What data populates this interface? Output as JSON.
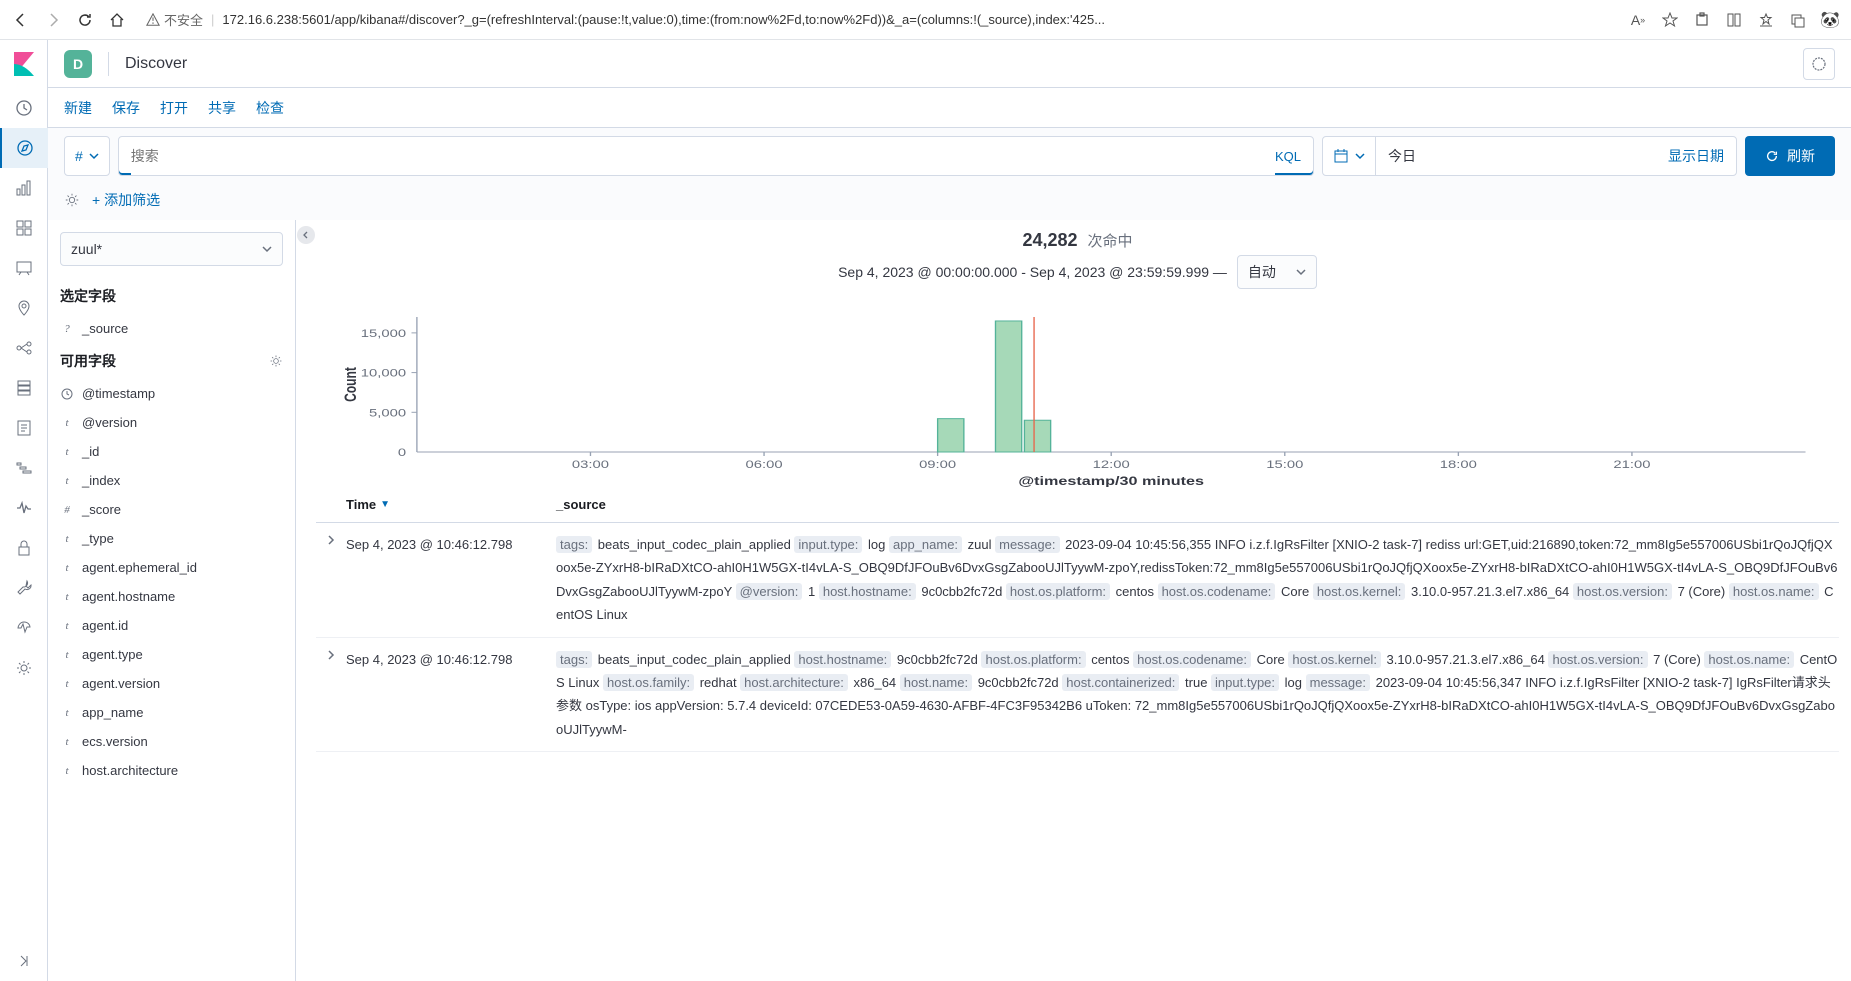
{
  "browser": {
    "insecure_label": "不安全",
    "url": "172.16.6.238:5601/app/kibana#/discover?_g=(refreshInterval:(pause:!t,value:0),time:(from:now%2Fd,to:now%2Fd))&_a=(columns:!(_source),index:'425..."
  },
  "header": {
    "space_letter": "D",
    "title": "Discover"
  },
  "actions": {
    "new": "新建",
    "save": "保存",
    "open": "打开",
    "share": "共享",
    "inspect": "检查"
  },
  "query": {
    "filter_hash": "#",
    "search_placeholder": "搜索",
    "kql": "KQL",
    "date_label": "今日",
    "show_dates": "显示日期",
    "refresh": "刷新",
    "add_filter": "+ 添加筛选"
  },
  "sidebar": {
    "index_pattern": "zuul*",
    "selected_fields_header": "选定字段",
    "selected_fields": [
      {
        "type": "?",
        "name": "_source"
      }
    ],
    "available_fields_header": "可用字段",
    "available_fields": [
      {
        "type": "clock",
        "name": "@timestamp"
      },
      {
        "type": "t",
        "name": "@version"
      },
      {
        "type": "t",
        "name": "_id"
      },
      {
        "type": "t",
        "name": "_index"
      },
      {
        "type": "#",
        "name": "_score"
      },
      {
        "type": "t",
        "name": "_type"
      },
      {
        "type": "t",
        "name": "agent.ephemeral_id"
      },
      {
        "type": "t",
        "name": "agent.hostname"
      },
      {
        "type": "t",
        "name": "agent.id"
      },
      {
        "type": "t",
        "name": "agent.type"
      },
      {
        "type": "t",
        "name": "agent.version"
      },
      {
        "type": "t",
        "name": "app_name"
      },
      {
        "type": "t",
        "name": "ecs.version"
      },
      {
        "type": "t",
        "name": "host.architecture"
      }
    ]
  },
  "results": {
    "hits_count": "24,282",
    "hits_label": "次命中",
    "time_range": "Sep 4, 2023 @ 00:00:00.000 - Sep 4, 2023 @ 23:59:59.999 —",
    "interval": "自动",
    "chart_xlabel": "@timestamp/30 minutes"
  },
  "chart_data": {
    "type": "bar",
    "ylabel": "Count",
    "xlabel": "@timestamp/30 minutes",
    "ylim": [
      0,
      17000
    ],
    "yticks": [
      0,
      5000,
      10000,
      15000
    ],
    "ytick_labels": [
      "0",
      "5,000",
      "10,000",
      "15,000"
    ],
    "xticks": [
      "03:00",
      "06:00",
      "09:00",
      "12:00",
      "15:00",
      "18:00",
      "21:00"
    ],
    "bars": [
      {
        "x_bucket": "09:00",
        "value": 4200
      },
      {
        "x_bucket": "10:00",
        "value": 16500
      },
      {
        "x_bucket": "10:30",
        "value": 4000
      }
    ],
    "current_time_marker": "10:40"
  },
  "table": {
    "col_time": "Time",
    "col_source": "_source",
    "rows": [
      {
        "time": "Sep 4, 2023 @ 10:46:12.798",
        "segments": [
          {
            "k": "tags:",
            "v": " beats_input_codec_plain_applied "
          },
          {
            "k": "input.type:",
            "v": " log "
          },
          {
            "k": "app_name:",
            "v": " zuul "
          },
          {
            "k": "message:",
            "v": " 2023-09-04 10:45:56,355 INFO i.z.f.IgRsFilter [XNIO-2 task-7] rediss url:GET,uid:216890,token:72_mm8Ig5e557006USbi1rQoJQfjQXoox5e-ZYxrH8-bIRaDXtCO-ahI0H1W5GX-tI4vLA-S_OBQ9DfJFOuBv6DvxGsgZabooUJlTyywM-zpoY,redissToken:72_mm8Ig5e557006USbi1rQoJQfjQXoox5e-ZYxrH8-bIRaDXtCO-ahI0H1W5GX-tI4vLA-S_OBQ9DfJFOuBv6DvxGsgZabooUJlTyywM-zpoY "
          },
          {
            "k": "@version:",
            "v": " 1 "
          },
          {
            "k": "host.hostname:",
            "v": " 9c0cbb2fc72d "
          },
          {
            "k": "host.os.platform:",
            "v": " centos "
          },
          {
            "k": "host.os.codename:",
            "v": " Core "
          },
          {
            "k": "host.os.kernel:",
            "v": " 3.10.0-957.21.3.el7.x86_64 "
          },
          {
            "k": "host.os.version:",
            "v": " 7 (Core) "
          },
          {
            "k": "host.os.name:",
            "v": " CentOS Linux"
          }
        ]
      },
      {
        "time": "Sep 4, 2023 @ 10:46:12.798",
        "segments": [
          {
            "k": "tags:",
            "v": " beats_input_codec_plain_applied "
          },
          {
            "k": "host.hostname:",
            "v": " 9c0cbb2fc72d "
          },
          {
            "k": "host.os.platform:",
            "v": " centos "
          },
          {
            "k": "host.os.codename:",
            "v": " Core "
          },
          {
            "k": "host.os.kernel:",
            "v": " 3.10.0-957.21.3.el7.x86_64 "
          },
          {
            "k": "host.os.version:",
            "v": " 7 (Core) "
          },
          {
            "k": "host.os.name:",
            "v": " CentOS Linux "
          },
          {
            "k": "host.os.family:",
            "v": " redhat "
          },
          {
            "k": "host.architecture:",
            "v": " x86_64 "
          },
          {
            "k": "host.name:",
            "v": " 9c0cbb2fc72d "
          },
          {
            "k": "host.containerized:",
            "v": " true "
          },
          {
            "k": "input.type:",
            "v": " log "
          },
          {
            "k": "message:",
            "v": " 2023-09-04 10:45:56,347 INFO i.z.f.IgRsFilter [XNIO-2 task-7] IgRsFilter请求头参数 osType: ios appVersion: 5.7.4 deviceId: 07CEDE53-0A59-4630-AFBF-4FC3F95342B6 uToken: 72_mm8Ig5e557006USbi1rQoJQfjQXoox5e-ZYxrH8-bIRaDXtCO-ahI0H1W5GX-tI4vLA-S_OBQ9DfJFOuBv6DvxGsgZabooUJlTyywM-"
          }
        ]
      }
    ]
  }
}
